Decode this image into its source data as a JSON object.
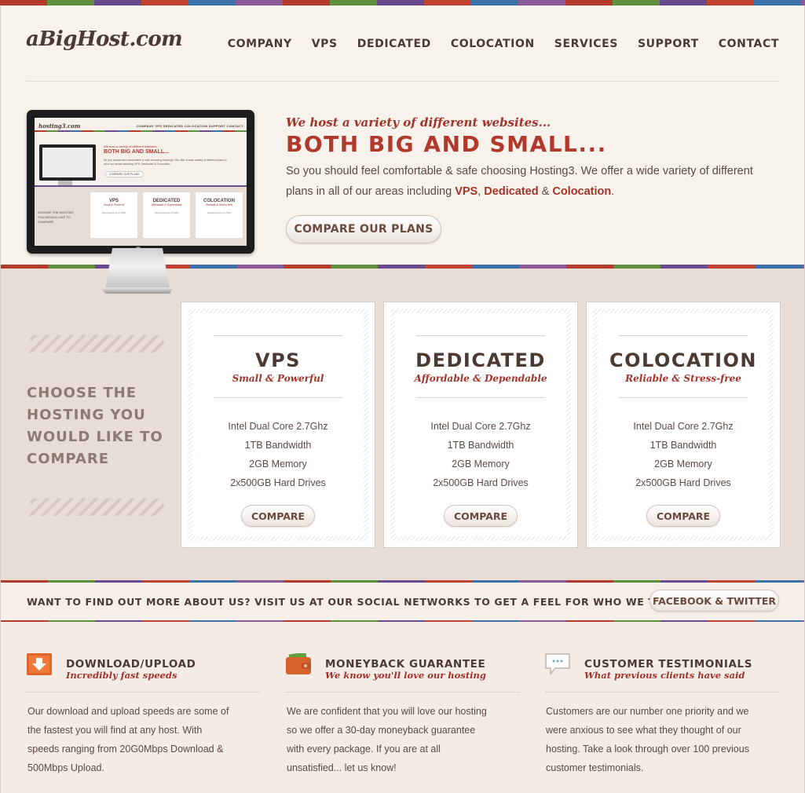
{
  "site": {
    "logo": "aBigHost.com",
    "nav": [
      "COMPANY",
      "VPS",
      "DEDICATED",
      "COLOCATION",
      "SERVICES",
      "SUPPORT",
      "CONTACT"
    ]
  },
  "hero": {
    "tagline": "We host a variety of different websites...",
    "headline": "BOTH BIG AND SMALL...",
    "intro_prefix": "So you should feel comfortable & safe choosing Hosting3. We offer a wide variety of different plans in all of our areas including ",
    "link_vps": "VPS",
    "sep1": ", ",
    "link_dedicated": "Dedicated",
    "sep2": " & ",
    "link_colocation": "Colocation",
    "intro_suffix": ".",
    "button": "COMPARE OUR PLANS"
  },
  "monitor_screen": {
    "logo": "hosting3.com",
    "nav": "COMPANY   VPS   DEDICATED   COLOCATION   SUPPORT   CONTACT",
    "tagline": "We host a variety of different websites...",
    "headline": "BOTH BIG AND SMALL...",
    "text": "So you should feel comfortable & safe choosing Hosting3. We offer a wide variety of different plans in all of our areas including VPS, Dedicated & Colocation.",
    "button": "COMPARE OUR PLANS",
    "choose": "CHOOSE THE HOSTING YOU WOULD LIKE TO COMPARE"
  },
  "compare": {
    "heading": "CHOOSE THE HOSTING YOU WOULD LIKE TO COMPARE",
    "plans": [
      {
        "title": "VPS",
        "subtitle": "Small & Powerful",
        "specs": [
          "Intel Dual Core 2.7Ghz",
          "1TB Bandwidth",
          "2GB Memory",
          "2x500GB Hard Drives"
        ],
        "button": "COMPARE"
      },
      {
        "title": "DEDICATED",
        "subtitle": "Affordable & Dependable",
        "specs": [
          "Intel Dual Core 2.7Ghz",
          "1TB Bandwidth",
          "2GB Memory",
          "2x500GB Hard Drives"
        ],
        "button": "COMPARE"
      },
      {
        "title": "COLOCATION",
        "subtitle": "Reliable & Stress-free",
        "specs": [
          "Intel Dual Core 2.7Ghz",
          "1TB Bandwidth",
          "2GB Memory",
          "2x500GB Hard Drives"
        ],
        "button": "COMPARE"
      }
    ]
  },
  "social": {
    "text": "WANT TO FIND OUT MORE ABOUT US? VISIT US AT OUR SOCIAL NETWORKS TO GET A FEEL FOR WHO WE TRULY ARE.",
    "button": "FACEBOOK & TWITTER"
  },
  "features": [
    {
      "icon": "download-icon",
      "title": "DOWNLOAD/UPLOAD",
      "subtitle": "Incredibly fast speeds",
      "body": "Our download and upload speeds are some of the fastest you will find at any host. With speeds ranging from 20G0Mbps Download & 500Mbps Upload."
    },
    {
      "icon": "wallet-icon",
      "title": "MONEYBACK GUARANTEE",
      "subtitle": "We know you'll love our hosting",
      "body": "We are confident that you will love our hosting so we offer a 30-day moneyback guarantee with every package. If you are at all unsatisfied... let us know!"
    },
    {
      "icon": "speech-bubble-icon",
      "title": "CUSTOMER TESTIMONIALS",
      "subtitle": "What previous clients have said",
      "body": "Customers are our number one priority and we were anxious to see what they thought of our hosting. Take a look through over 100 previous customer testimonials."
    }
  ],
  "colors": {
    "accent": "#b0392b",
    "text": "#4b3a33",
    "band": "#e8ddd5"
  }
}
